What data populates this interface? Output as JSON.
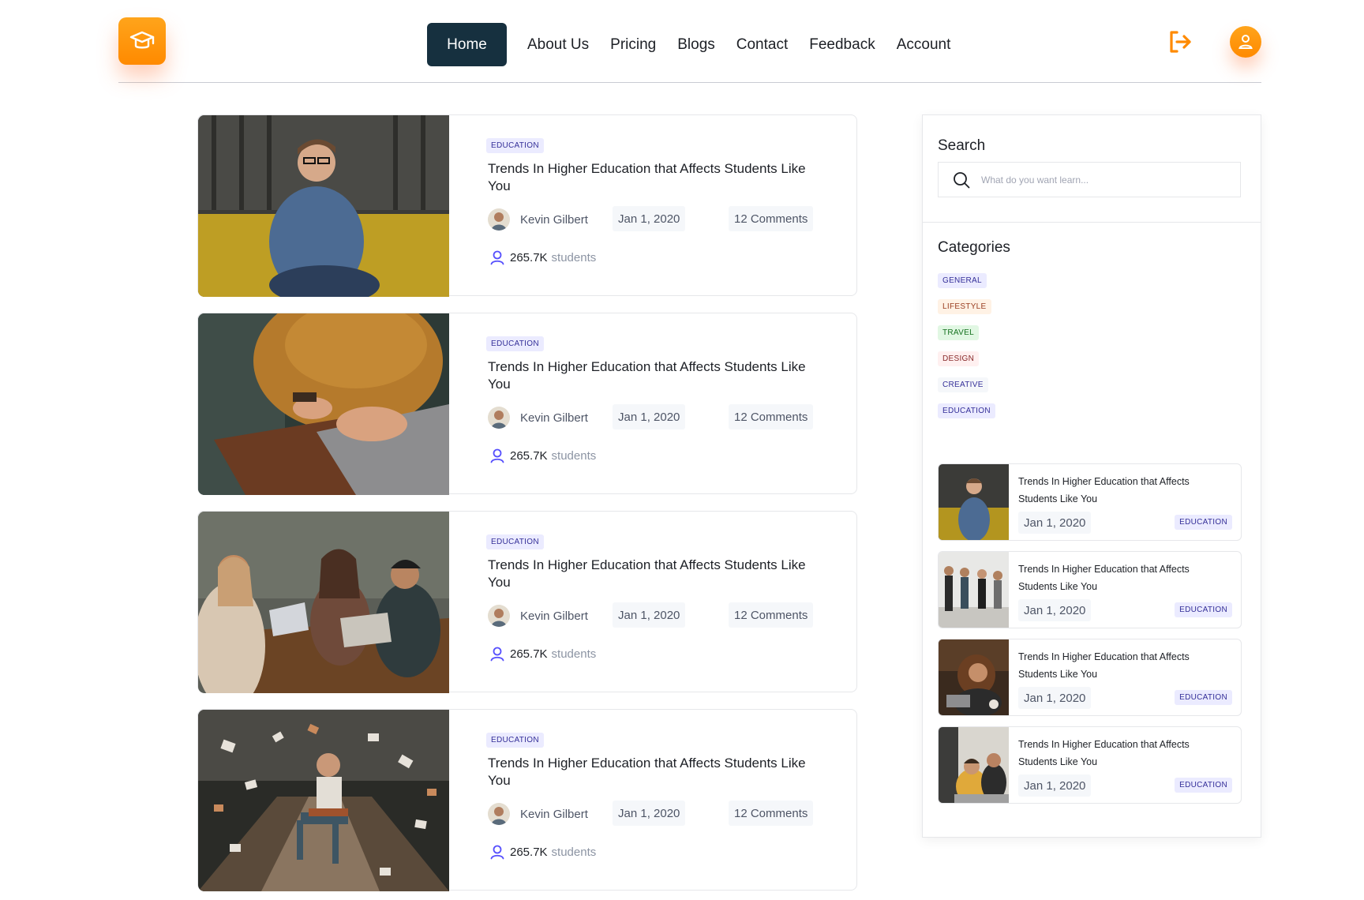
{
  "nav": {
    "items": [
      "Home",
      "About Us",
      "Pricing",
      "Blogs",
      "Contact",
      "Feedback",
      "Account"
    ],
    "active": "Home"
  },
  "posts": [
    {
      "category": "EDUCATION",
      "title": "Trends In Higher Education that Affects Students Like You",
      "author": "Kevin Gilbert",
      "date": "Jan 1, 2020",
      "comments": "12 Comments",
      "students_count": "265.7K",
      "students_label": "students"
    },
    {
      "category": "EDUCATION",
      "title": "Trends In Higher Education that Affects Students Like You",
      "author": "Kevin Gilbert",
      "date": "Jan 1, 2020",
      "comments": "12 Comments",
      "students_count": "265.7K",
      "students_label": "students"
    },
    {
      "category": "EDUCATION",
      "title": "Trends In Higher Education that Affects Students Like You",
      "author": "Kevin Gilbert",
      "date": "Jan 1, 2020",
      "comments": "12 Comments",
      "students_count": "265.7K",
      "students_label": "students"
    },
    {
      "category": "EDUCATION",
      "title": "Trends In Higher Education that Affects Students Like You",
      "author": "Kevin Gilbert",
      "date": "Jan 1, 2020",
      "comments": "12 Comments",
      "students_count": "265.7K",
      "students_label": "students"
    }
  ],
  "sidebar": {
    "search_title": "Search",
    "search_placeholder": "What do you want learn...",
    "categories_title": "Categories",
    "categories": [
      {
        "label": "GENERAL",
        "bg": "#ebebff",
        "color": "#342f98"
      },
      {
        "label": "LIFESTYLE",
        "bg": "#fff2e5",
        "color": "#993d20"
      },
      {
        "label": "TRAVEL",
        "bg": "#e1f7e3",
        "color": "#15711f"
      },
      {
        "label": "DESIGN",
        "bg": "#fff0f0",
        "color": "#882929"
      },
      {
        "label": "CREATIVE",
        "bg": "#f5f7fa",
        "color": "#342f98"
      },
      {
        "label": "EDUCATION",
        "bg": "#ebebff",
        "color": "#342f98"
      }
    ],
    "recent_posts": [
      {
        "title": "Trends In Higher Education that Affects Students Like You",
        "date": "Jan 1, 2020",
        "category": "EDUCATION"
      },
      {
        "title": "Trends In Higher Education that Affects Students Like You",
        "date": "Jan 1, 2020",
        "category": "EDUCATION"
      },
      {
        "title": "Trends In Higher Education that Affects Students Like You",
        "date": "Jan 1, 2020",
        "category": "EDUCATION"
      },
      {
        "title": "Trends In Higher Education that Affects Students Like You",
        "date": "Jan 1, 2020",
        "category": "EDUCATION"
      }
    ]
  },
  "icons": {
    "logo": "graduation-cap-icon",
    "logout": "logout-icon",
    "account": "user-icon",
    "search": "search-icon",
    "students": "user-outline-icon"
  },
  "colors": {
    "brand_orange": "#ff8a00",
    "nav_active_bg": "#16303f",
    "students_icon": "#564ffd"
  }
}
